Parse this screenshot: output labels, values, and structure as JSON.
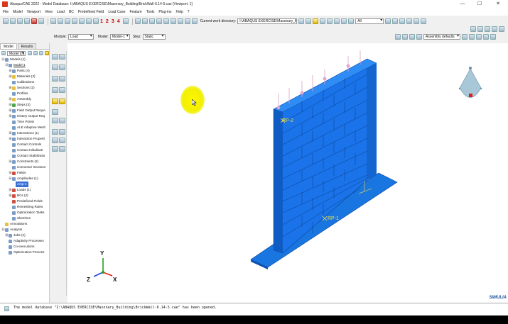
{
  "window": {
    "title": "Abaqus/CAE 2022 - Model Database: I:\\ABAQUS EXERCISE\\Masonary_Building\\BrickWall-6.14-5.cae [Viewport: 1]",
    "controls": [
      "—",
      "☐",
      "✕"
    ]
  },
  "menu": [
    "File",
    "Model",
    "Viewport",
    "View",
    "Load",
    "BC",
    "Predefined Field",
    "Load Case",
    "Feature",
    "Tools",
    "Plug-ins",
    "Help",
    "?"
  ],
  "toolbar1": {
    "numbers": [
      "1",
      "2",
      "3",
      "4"
    ],
    "cwd_label": "Current work directory:",
    "cwd_value": "I:\\ABAQUS EXERCISE\\Masonary_Building",
    "filter_value": "All"
  },
  "toolbar2": {
    "assembly_defaults": "Assembly defaults"
  },
  "context": {
    "module_label": "Module:",
    "module_value": "Load",
    "model_label": "Model:",
    "model_value": "Model-1",
    "step_label": "Step:",
    "step_value": "Static"
  },
  "left_panel": {
    "tabs": [
      "Model",
      "Results"
    ],
    "tree_select": "Model Da",
    "tree": [
      {
        "label": "Models (1)",
        "exp": "⊟",
        "icon": "blue"
      },
      {
        "label": "Model-1",
        "exp": "⊟",
        "icon": "blue",
        "underline": true
      },
      {
        "label": "Parts (4)",
        "exp": "⊞",
        "icon": "blue"
      },
      {
        "label": "Materials (2)",
        "exp": "⊞",
        "icon": "yellow"
      },
      {
        "label": "Calibrations",
        "exp": "",
        "icon": "blue"
      },
      {
        "label": "Sections (2)",
        "exp": "⊞",
        "icon": "yellow"
      },
      {
        "label": "Profiles",
        "exp": "",
        "icon": "blue"
      },
      {
        "label": "Assembly",
        "exp": "⊞",
        "icon": "yellow"
      },
      {
        "label": "Steps (3)",
        "exp": "⊞",
        "icon": "green"
      },
      {
        "label": "Field Output Reque",
        "exp": "⊞",
        "icon": "blue"
      },
      {
        "label": "History Output Req",
        "exp": "⊞",
        "icon": "blue"
      },
      {
        "label": "Time Points",
        "exp": "",
        "icon": "blue"
      },
      {
        "label": "ALE Adaptive Mesh",
        "exp": "",
        "icon": "blue"
      },
      {
        "label": "Interactions (1)",
        "exp": "⊞",
        "icon": "blue"
      },
      {
        "label": "Interaction Properti",
        "exp": "⊞",
        "icon": "blue"
      },
      {
        "label": "Contact Controls",
        "exp": "",
        "icon": "blue"
      },
      {
        "label": "Contact Initializati",
        "exp": "",
        "icon": "blue"
      },
      {
        "label": "Contact Stabilizatio",
        "exp": "",
        "icon": "blue"
      },
      {
        "label": "Constraints (2)",
        "exp": "⊞",
        "icon": "blue"
      },
      {
        "label": "Connector Sections",
        "exp": "",
        "icon": "blue"
      },
      {
        "label": "Fields",
        "exp": "⊞",
        "icon": "red"
      },
      {
        "label": "Amplitudes (1)",
        "exp": "⊟",
        "icon": "blue"
      },
      {
        "label": "Amp-1",
        "exp": "",
        "icon": "none",
        "selected": true
      },
      {
        "label": "Loads (1)",
        "exp": "⊞",
        "icon": "red"
      },
      {
        "label": "BCs (2)",
        "exp": "⊞",
        "icon": "red"
      },
      {
        "label": "Predefined Fields",
        "exp": "",
        "icon": "red"
      },
      {
        "label": "Remeshing Rules",
        "exp": "",
        "icon": "blue"
      },
      {
        "label": "Optimization Tasks",
        "exp": "",
        "icon": "blue"
      },
      {
        "label": "Sketches",
        "exp": "",
        "icon": "blue"
      },
      {
        "label": "Annotations",
        "exp": "",
        "icon": "yellow",
        "top": true
      },
      {
        "label": "Analysis",
        "exp": "⊟",
        "icon": "blue",
        "top": true
      },
      {
        "label": "Jobs (2)",
        "exp": "⊞",
        "icon": "blue"
      },
      {
        "label": "Adaptivity Processes",
        "exp": "",
        "icon": "blue"
      },
      {
        "label": "Co-executions",
        "exp": "",
        "icon": "blue"
      },
      {
        "label": "Optimization Process",
        "exp": "",
        "icon": "blue"
      }
    ]
  },
  "viewport": {
    "rp_labels": [
      "RP-2",
      "RP-1"
    ],
    "triad": {
      "y": "Y",
      "x": "X",
      "z": "Z"
    },
    "logo": "SIMULIA"
  },
  "message": "The model database \"I:\\ABAQUS EXERCISE\\Masonary_Building\\BrickWall-6.14-5.cae\" has been opened.",
  "colors": {
    "wall": "#1a73e8",
    "wall_dark": "#0d47a1",
    "wall_top": "#2f8cf5",
    "accent": "#3a6fd8"
  }
}
